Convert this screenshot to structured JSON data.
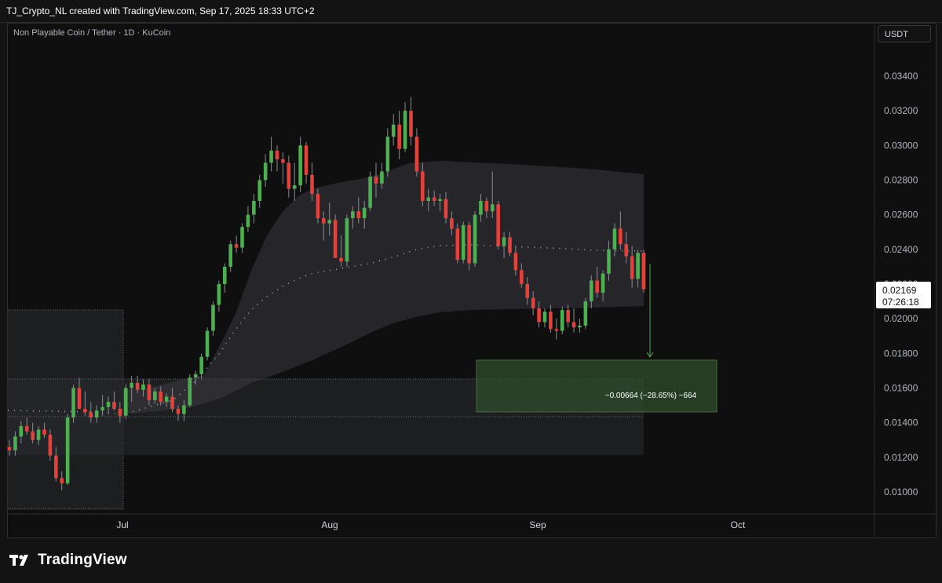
{
  "header": {
    "attribution": "TJ_Crypto_NL created with TradingView.com, Sep 17, 2025 18:33 UTC+2"
  },
  "chart_header": {
    "symbol": "Non Playable Coin / Tether · 1D · KuCoin",
    "currency": "USDT"
  },
  "price_axis": [
    "0.03400",
    "0.03200",
    "0.03000",
    "0.02800",
    "0.02600",
    "0.02400",
    "0.02200",
    "0.02000",
    "0.01800",
    "0.01600",
    "0.01400",
    "0.01200",
    "0.01000"
  ],
  "time_axis": [
    "Jul",
    "Aug",
    "Sep",
    "Oct"
  ],
  "last_price": {
    "price": "0.02169",
    "countdown": "07:26:18"
  },
  "measure": {
    "label": "−0.00664 (−28.65%) −664"
  },
  "footer": {
    "brand": "TradingView"
  },
  "colors": {
    "up": "#4caf50",
    "down": "#e5403a",
    "bg": "#0f0f0f",
    "grid": "#1a1a1a",
    "text": "#b2b5be"
  },
  "chart_data": {
    "type": "candlestick",
    "ylim": [
      0.009,
      0.036
    ],
    "candles": [
      [
        0.0126,
        0.013,
        0.0121,
        0.0124
      ],
      [
        0.0124,
        0.0135,
        0.0121,
        0.0132
      ],
      [
        0.0132,
        0.0141,
        0.0128,
        0.0138
      ],
      [
        0.0138,
        0.0143,
        0.0133,
        0.0135
      ],
      [
        0.0135,
        0.014,
        0.0128,
        0.013
      ],
      [
        0.013,
        0.0138,
        0.0127,
        0.0136
      ],
      [
        0.0136,
        0.014,
        0.0131,
        0.0133
      ],
      [
        0.0133,
        0.0136,
        0.0118,
        0.0121
      ],
      [
        0.0121,
        0.0126,
        0.0106,
        0.0108
      ],
      [
        0.0108,
        0.0112,
        0.0101,
        0.0105
      ],
      [
        0.0105,
        0.0145,
        0.0104,
        0.0143
      ],
      [
        0.0143,
        0.0162,
        0.014,
        0.016
      ],
      [
        0.016,
        0.0166,
        0.0148,
        0.0148
      ],
      [
        0.0148,
        0.0158,
        0.0144,
        0.0146
      ],
      [
        0.0146,
        0.0152,
        0.014,
        0.0143
      ],
      [
        0.0143,
        0.015,
        0.014,
        0.0147
      ],
      [
        0.0147,
        0.0156,
        0.0144,
        0.0149
      ],
      [
        0.0149,
        0.0155,
        0.0145,
        0.0152
      ],
      [
        0.0152,
        0.0158,
        0.0147,
        0.0148
      ],
      [
        0.0148,
        0.0152,
        0.014,
        0.0144
      ],
      [
        0.0144,
        0.0162,
        0.0142,
        0.016
      ],
      [
        0.016,
        0.0167,
        0.0152,
        0.0163
      ],
      [
        0.0163,
        0.0167,
        0.0157,
        0.0159
      ],
      [
        0.0159,
        0.0165,
        0.0155,
        0.0162
      ],
      [
        0.0162,
        0.0165,
        0.015,
        0.0153
      ],
      [
        0.0153,
        0.016,
        0.0151,
        0.0158
      ],
      [
        0.0158,
        0.0161,
        0.015,
        0.0152
      ],
      [
        0.0152,
        0.0157,
        0.0149,
        0.0155
      ],
      [
        0.0155,
        0.016,
        0.0146,
        0.0148
      ],
      [
        0.0148,
        0.015,
        0.0141,
        0.0145
      ],
      [
        0.0145,
        0.0153,
        0.0141,
        0.015
      ],
      [
        0.015,
        0.0168,
        0.0149,
        0.0166
      ],
      [
        0.0166,
        0.017,
        0.0162,
        0.0168
      ],
      [
        0.0168,
        0.018,
        0.0165,
        0.0178
      ],
      [
        0.0178,
        0.0195,
        0.0176,
        0.0193
      ],
      [
        0.0193,
        0.021,
        0.019,
        0.0208
      ],
      [
        0.0208,
        0.0222,
        0.0204,
        0.022
      ],
      [
        0.022,
        0.0232,
        0.0215,
        0.023
      ],
      [
        0.023,
        0.0245,
        0.0227,
        0.0243
      ],
      [
        0.0243,
        0.0248,
        0.0238,
        0.0241
      ],
      [
        0.0241,
        0.0255,
        0.0238,
        0.0253
      ],
      [
        0.0253,
        0.0265,
        0.025,
        0.026
      ],
      [
        0.026,
        0.0272,
        0.0255,
        0.0268
      ],
      [
        0.0268,
        0.0283,
        0.0264,
        0.028
      ],
      [
        0.028,
        0.0295,
        0.0276,
        0.029
      ],
      [
        0.029,
        0.0305,
        0.0285,
        0.0297
      ],
      [
        0.0297,
        0.03,
        0.0285,
        0.0292
      ],
      [
        0.0292,
        0.0296,
        0.0278,
        0.029
      ],
      [
        0.029,
        0.0294,
        0.027,
        0.0275
      ],
      [
        0.0275,
        0.029,
        0.0268,
        0.0277
      ],
      [
        0.0277,
        0.0305,
        0.0273,
        0.03
      ],
      [
        0.03,
        0.0302,
        0.0278,
        0.0283
      ],
      [
        0.0283,
        0.029,
        0.0268,
        0.0272
      ],
      [
        0.0272,
        0.0275,
        0.0255,
        0.0258
      ],
      [
        0.0258,
        0.0262,
        0.0245,
        0.0255
      ],
      [
        0.0255,
        0.0267,
        0.0248,
        0.0257
      ],
      [
        0.0257,
        0.026,
        0.024,
        0.0235
      ],
      [
        0.0235,
        0.0248,
        0.023,
        0.0233
      ],
      [
        0.0233,
        0.026,
        0.023,
        0.0258
      ],
      [
        0.0258,
        0.0265,
        0.0252,
        0.0262
      ],
      [
        0.0262,
        0.027,
        0.0255,
        0.0258
      ],
      [
        0.0258,
        0.0268,
        0.0252,
        0.0264
      ],
      [
        0.0264,
        0.0285,
        0.0262,
        0.0282
      ],
      [
        0.0282,
        0.029,
        0.027,
        0.0278
      ],
      [
        0.0278,
        0.029,
        0.0275,
        0.0285
      ],
      [
        0.0285,
        0.031,
        0.0282,
        0.0305
      ],
      [
        0.0305,
        0.0318,
        0.03,
        0.0312
      ],
      [
        0.0312,
        0.032,
        0.0292,
        0.0298
      ],
      [
        0.0298,
        0.0325,
        0.0296,
        0.032
      ],
      [
        0.032,
        0.0328,
        0.03,
        0.0305
      ],
      [
        0.0305,
        0.031,
        0.0282,
        0.0285
      ],
      [
        0.0285,
        0.029,
        0.0265,
        0.0268
      ],
      [
        0.0268,
        0.0275,
        0.0262,
        0.027
      ],
      [
        0.027,
        0.0274,
        0.0265,
        0.0268
      ],
      [
        0.0268,
        0.0272,
        0.0262,
        0.0269
      ],
      [
        0.0269,
        0.0273,
        0.0255,
        0.0258
      ],
      [
        0.0258,
        0.0262,
        0.0248,
        0.0252
      ],
      [
        0.0252,
        0.0255,
        0.0232,
        0.0234
      ],
      [
        0.0234,
        0.0256,
        0.0232,
        0.0254
      ],
      [
        0.0254,
        0.0256,
        0.0228,
        0.0232
      ],
      [
        0.0232,
        0.0262,
        0.023,
        0.026
      ],
      [
        0.026,
        0.0272,
        0.0256,
        0.0268
      ],
      [
        0.0268,
        0.027,
        0.0258,
        0.0262
      ],
      [
        0.0262,
        0.0285,
        0.0258,
        0.0266
      ],
      [
        0.0266,
        0.0268,
        0.024,
        0.0242
      ],
      [
        0.0242,
        0.025,
        0.0235,
        0.0247
      ],
      [
        0.0247,
        0.025,
        0.0236,
        0.0238
      ],
      [
        0.0238,
        0.0242,
        0.0225,
        0.0228
      ],
      [
        0.0228,
        0.0232,
        0.0218,
        0.022
      ],
      [
        0.022,
        0.0224,
        0.0208,
        0.0212
      ],
      [
        0.0212,
        0.0216,
        0.0202,
        0.0206
      ],
      [
        0.0206,
        0.021,
        0.0195,
        0.0198
      ],
      [
        0.0198,
        0.0206,
        0.0195,
        0.0204
      ],
      [
        0.0204,
        0.0208,
        0.0192,
        0.0194
      ],
      [
        0.0194,
        0.02,
        0.0188,
        0.0193
      ],
      [
        0.0193,
        0.0207,
        0.0191,
        0.0205
      ],
      [
        0.0205,
        0.0208,
        0.0195,
        0.0198
      ],
      [
        0.0198,
        0.0206,
        0.0192,
        0.0195
      ],
      [
        0.0195,
        0.02,
        0.0192,
        0.0196
      ],
      [
        0.0196,
        0.0212,
        0.0194,
        0.021
      ],
      [
        0.021,
        0.0225,
        0.0206,
        0.0222
      ],
      [
        0.0222,
        0.023,
        0.0212,
        0.0215
      ],
      [
        0.0215,
        0.0228,
        0.021,
        0.0226
      ],
      [
        0.0226,
        0.0245,
        0.0222,
        0.024
      ],
      [
        0.024,
        0.0255,
        0.0236,
        0.0252
      ],
      [
        0.0252,
        0.0262,
        0.024,
        0.0243
      ],
      [
        0.0243,
        0.025,
        0.0232,
        0.0236
      ],
      [
        0.0236,
        0.0242,
        0.0218,
        0.0223
      ],
      [
        0.0223,
        0.024,
        0.0218,
        0.0238
      ],
      [
        0.0238,
        0.024,
        0.0215,
        0.0217
      ]
    ]
  }
}
